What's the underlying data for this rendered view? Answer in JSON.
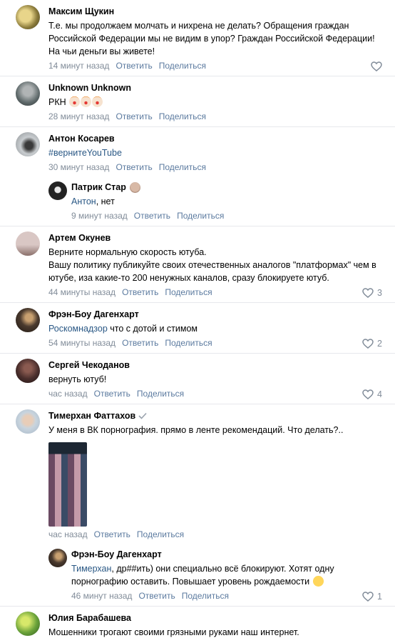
{
  "comments": [
    {
      "author": "Максим Щукин",
      "text": "Т.е. мы продолжаем молчать и нихрена не делать? Обращения граждан Российской Федерации мы не видим в упор? Граждан Российской Федерации! На чьи деньги вы живете!",
      "time": "14 минут назад",
      "reply": "Ответить",
      "share": "Поделиться",
      "likes": "",
      "avatar_color": "#8a7a3a"
    },
    {
      "author": "Unknown Unknown",
      "text": "РКН",
      "time": "28 минут назад",
      "reply": "Ответить",
      "share": "Поделиться",
      "likes": "",
      "avatar_color": "#6f7b7c",
      "emojis": [
        "clown-emoji",
        "clown-emoji",
        "clown-emoji"
      ]
    },
    {
      "author": "Антон Косарев",
      "text": "#вернитеYouTube",
      "time": "30 минут назад",
      "reply": "Ответить",
      "share": "Поделиться",
      "likes": "",
      "avatar_color": "#9aa0a3"
    },
    {
      "author": "Патрик Стар",
      "reply_to": "Антон",
      "text": ", нет",
      "time": "9 минут назад",
      "reply": "Ответить",
      "share": "Поделиться",
      "likes": "",
      "avatar_color": "#222222"
    },
    {
      "author": "Артем Окунев",
      "text": "Верните нормальную скорость ютуба.\nВашу политику публикуйте своих отечественных аналогов \"платформах\" чем в ютубе, иза какие-то 200 ненужных каналов, сразу блокируете ютуб.",
      "time": "44 минуты назад",
      "reply": "Ответить",
      "share": "Поделиться",
      "likes": "3",
      "avatar_color": "#b29a96"
    },
    {
      "author": "Фрэн-Боу Дагенхарт",
      "reply_to": "Роскомнадзор",
      "text": " что с дотой и стимом",
      "time": "54 минуты назад",
      "reply": "Ответить",
      "share": "Поделиться",
      "likes": "2",
      "avatar_color": "#4a3a2e"
    },
    {
      "author": "Сергей Чекоданов",
      "text": "вернуть ютуб!",
      "time": "час назад",
      "reply": "Ответить",
      "share": "Поделиться",
      "likes": "4",
      "avatar_color": "#5a3a3a"
    },
    {
      "author": "Тимерхан Фаттахов",
      "text": "У меня в ВК порнография. прямо в ленте рекомендаций. Что делать?..",
      "time": "час назад",
      "reply": "Ответить",
      "share": "Поделиться",
      "likes": "",
      "avatar_color": "#a8b8c8"
    },
    {
      "author": "Фрэн-Боу Дагенхарт",
      "reply_to": "Тимерхан",
      "text": ", др##ить) они специально всё блокируют. Хотят одну порнографию оставить. Повышает уровень рождаемости",
      "time": "46 минут назад",
      "reply": "Ответить",
      "share": "Поделиться",
      "likes": "1",
      "avatar_color": "#4a3a2e"
    },
    {
      "author": "Юлия Барабашева",
      "text": "Мошенники трогают своими грязными руками наш интернет.",
      "avatar_color": "#6aa23a"
    }
  ]
}
